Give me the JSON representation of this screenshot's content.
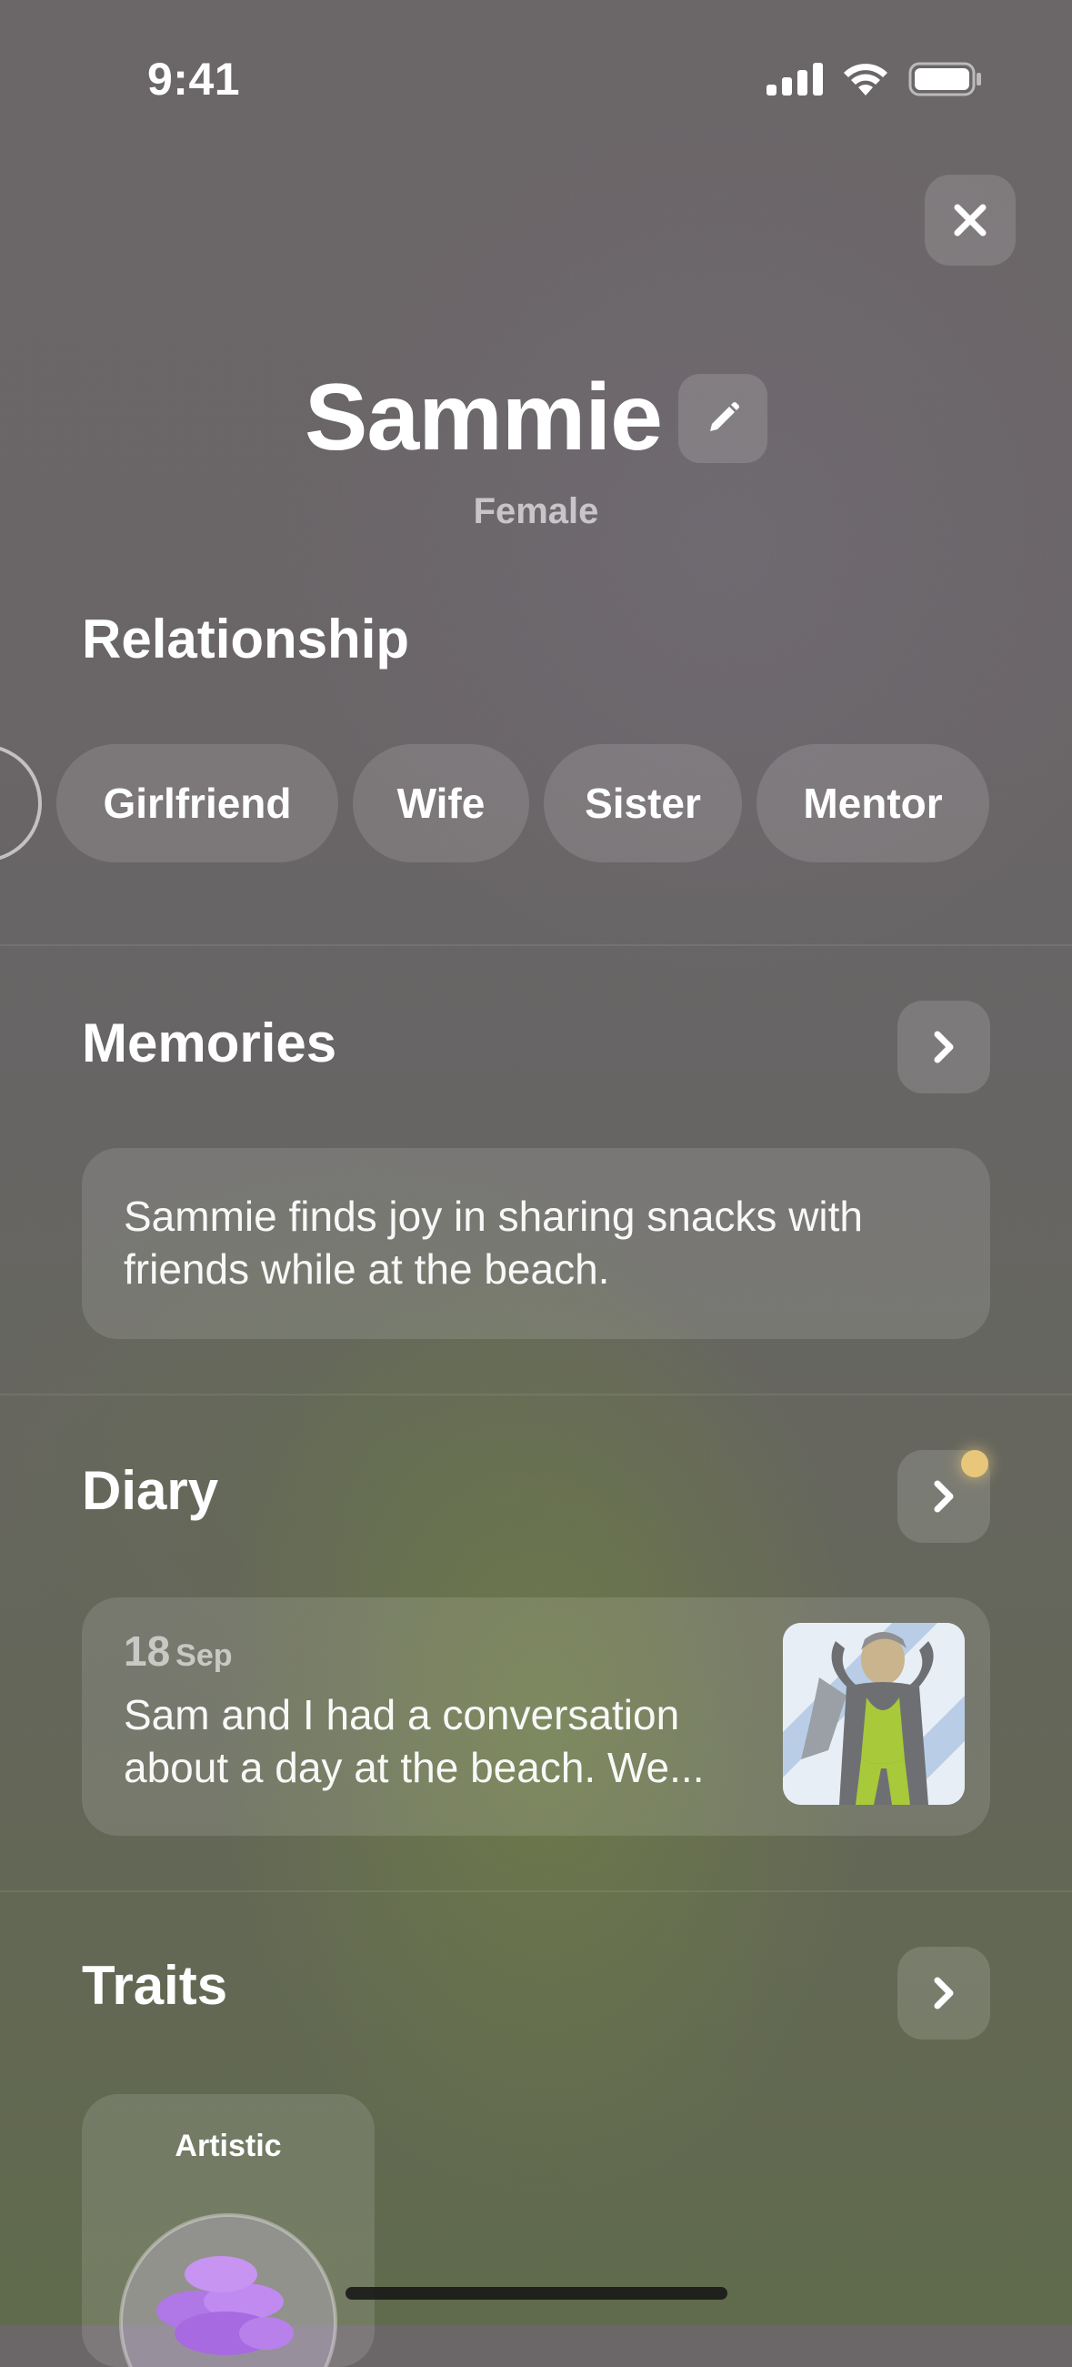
{
  "status_bar": {
    "time": "9:41",
    "icons": [
      "cellular-signal-icon",
      "wifi-icon",
      "battery-icon"
    ]
  },
  "profile": {
    "name": "Sammie",
    "gender": "Female"
  },
  "relationship": {
    "title": "Relationship",
    "options": [
      "Girlfriend",
      "Wife",
      "Sister",
      "Mentor"
    ]
  },
  "memories": {
    "title": "Memories",
    "text": "Sammie finds joy in sharing snacks with friends while at the beach."
  },
  "diary": {
    "title": "Diary",
    "entry": {
      "day": "18",
      "month": "Sep",
      "line1": "Sam and I had a conversation",
      "line2": "about a day at the beach. We..."
    },
    "has_new": true
  },
  "traits": {
    "title": "Traits",
    "items": [
      {
        "label": "Artistic"
      }
    ]
  },
  "colors": {
    "accent_dot": "#e8c77a",
    "trait_orb": "#b077e6"
  }
}
